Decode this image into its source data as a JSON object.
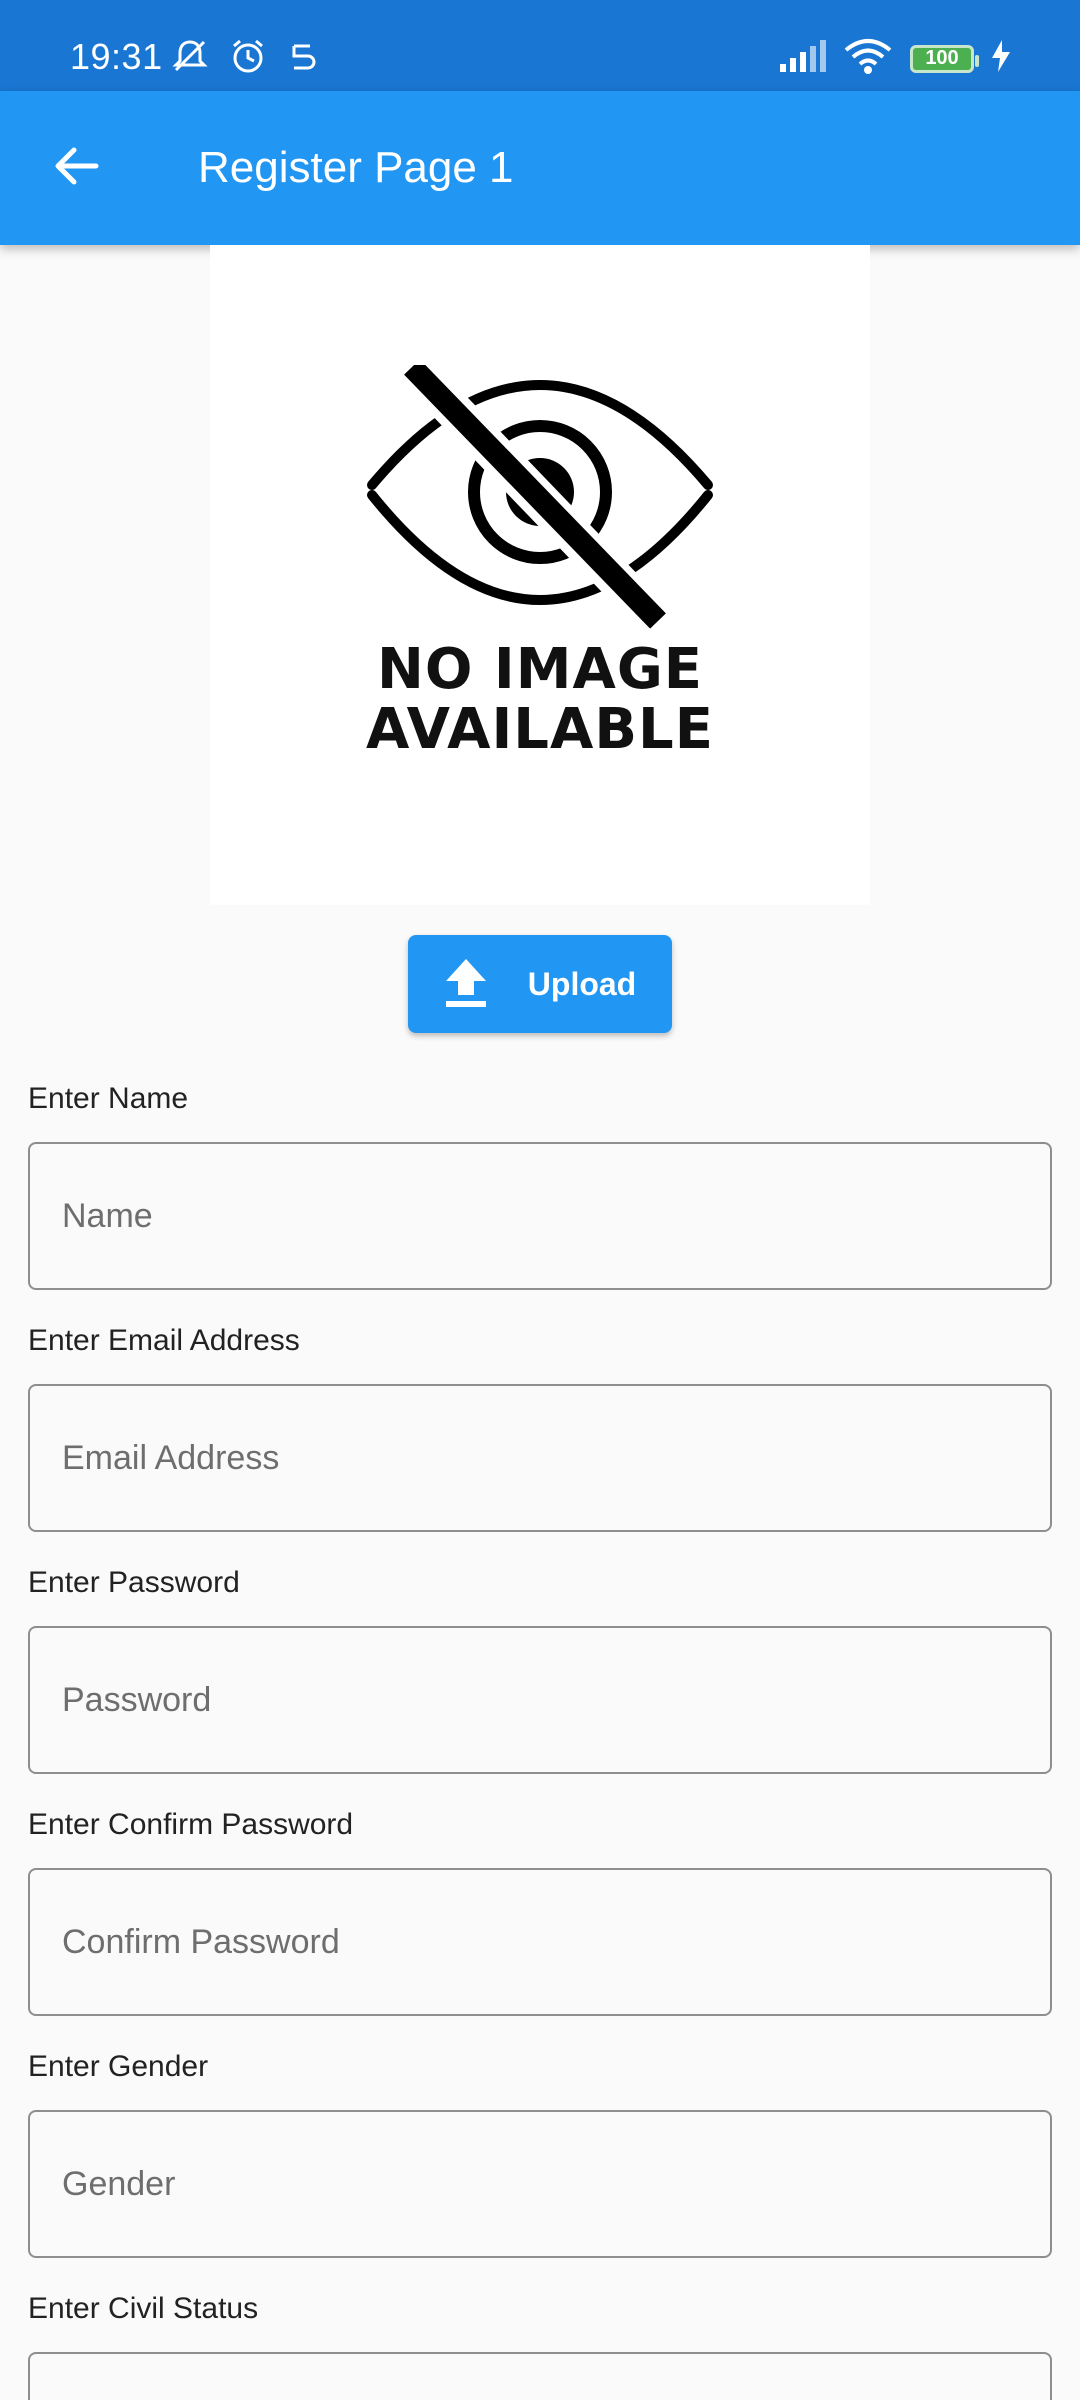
{
  "status_bar": {
    "time": "19:31",
    "battery": "100",
    "icons": [
      "muted-notification-icon",
      "alarm-icon",
      "sync-icon",
      "signal-icon",
      "wifi-icon",
      "battery-icon",
      "charging-icon"
    ]
  },
  "app_bar": {
    "title": "Register Page 1",
    "back_icon": "arrow-back-icon",
    "color": "#2196f3"
  },
  "image_placeholder": {
    "line1": "NO IMAGE",
    "line2": "AVAILABLE"
  },
  "upload": {
    "label": "Upload",
    "icon": "upload-icon"
  },
  "form": {
    "fields": [
      {
        "label": "Enter Name",
        "placeholder": "Name",
        "value": ""
      },
      {
        "label": "Enter Email Address",
        "placeholder": "Email Address",
        "value": ""
      },
      {
        "label": "Enter Password",
        "placeholder": "Password",
        "value": ""
      },
      {
        "label": "Enter Confirm Password",
        "placeholder": "Confirm Password",
        "value": ""
      },
      {
        "label": "Enter Gender",
        "placeholder": "Gender",
        "value": ""
      },
      {
        "label": "Enter Civil Status",
        "placeholder": "",
        "value": ""
      }
    ]
  }
}
